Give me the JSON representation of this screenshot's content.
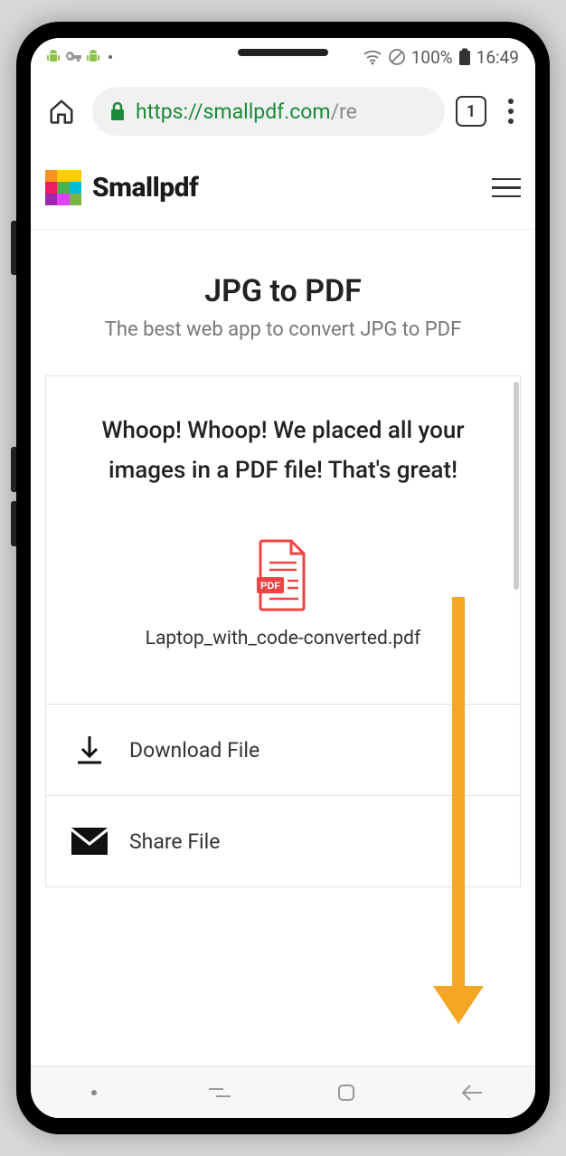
{
  "status_bar": {
    "battery_pct": "100%",
    "time": "16:49"
  },
  "browser": {
    "url_scheme": "https://",
    "url_host": "smallpdf.com",
    "url_path": "/re",
    "tab_count": "1"
  },
  "site": {
    "brand": "Smallpdf",
    "hero_title": "JPG to PDF",
    "hero_sub": "The best web app to convert JPG to PDF"
  },
  "result": {
    "success_msg": "Whoop! Whoop! We placed all your images in a PDF file! That's great!",
    "file_badge": "PDF",
    "file_name": "Laptop_with_code-converted.pdf",
    "download_label": "Download File",
    "share_label": "Share File"
  }
}
